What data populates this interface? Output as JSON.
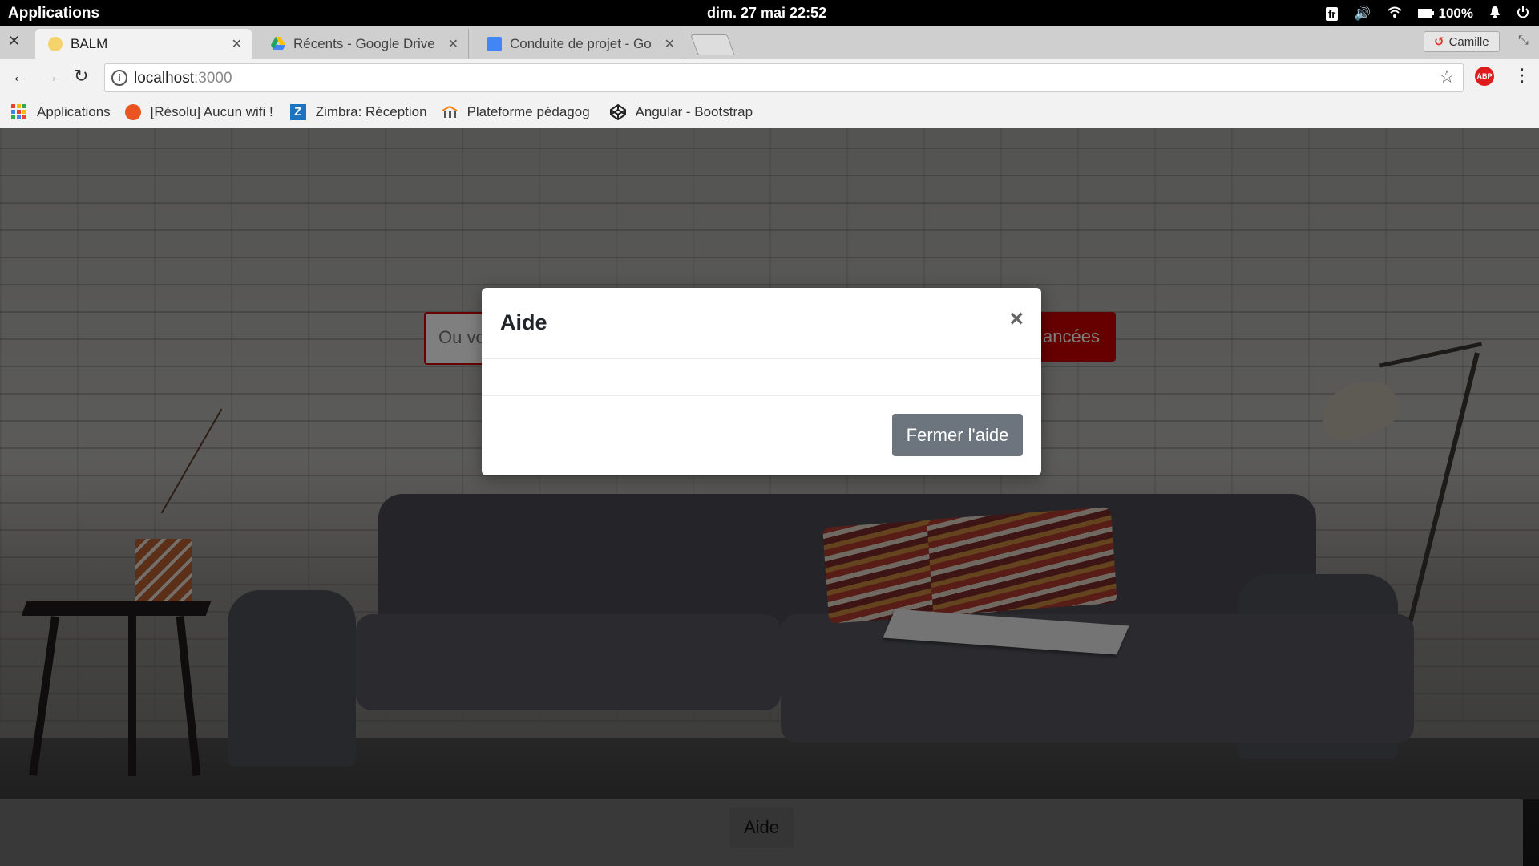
{
  "os": {
    "apps_label": "Applications",
    "clock": "dim. 27 mai   22:52",
    "keyboard_layout": "fr",
    "battery": "100%"
  },
  "browser": {
    "tabs": [
      {
        "title": "BALM",
        "active": true,
        "favicon_color": "#f6d26a"
      },
      {
        "title": "Récents - Google Drive",
        "active": false,
        "favicon_color": "#1fa463"
      },
      {
        "title": "Conduite de projet - Go",
        "active": false,
        "favicon_color": "#4285f4"
      }
    ],
    "profile_name": "Camille",
    "url_host": "localhost",
    "url_port": ":3000",
    "abp_label": "ABP",
    "bookmarks": [
      {
        "label": "Applications",
        "icon": "apps-grid-icon"
      },
      {
        "label": "[Résolu] Aucun wifi !",
        "icon": "ubuntu-icon"
      },
      {
        "label": "Zimbra: Réception",
        "icon": "zimbra-icon"
      },
      {
        "label": "Plateforme pédagog",
        "icon": "moodle-icon"
      },
      {
        "label": "Angular - Bootstrap",
        "icon": "codepen-icon"
      }
    ]
  },
  "page": {
    "search_placeholder": "Ou vo",
    "advanced_button_partial": "ancées",
    "footer_button": "Aide"
  },
  "modal": {
    "title": "Aide",
    "close_glyph": "×",
    "close_button": "Fermer l'aide"
  },
  "colors": {
    "accent_red": "#cc0000",
    "modal_button": "#6c757d"
  }
}
